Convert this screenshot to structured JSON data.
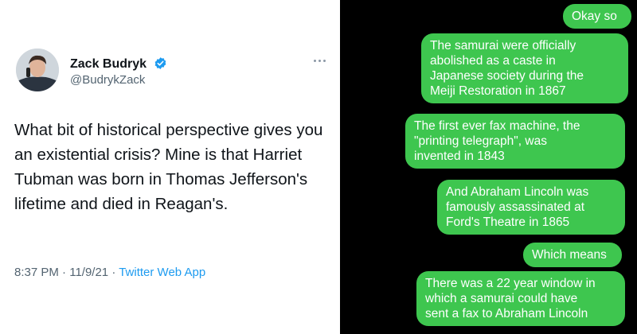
{
  "tweet": {
    "display_name": "Zack Budryk",
    "handle": "@BudrykZack",
    "text": "What bit of historical perspective gives you an existential crisis? Mine is that Harriet Tubman was born in Thomas Jefferson's lifetime and died in Reagan's.",
    "time": "8:37 PM",
    "date": "11/9/21",
    "source": "Twitter Web App",
    "separator": " · "
  },
  "chat": {
    "bubble_color": "#3ec64f",
    "messages": [
      "Okay so",
      "The samurai were officially\nabolished as a caste in\nJapanese society during the\nMeiji Restoration in 1867",
      "The first ever fax machine, the\n\"printing telegraph\", was\ninvented in 1843",
      "And Abraham Lincoln was\nfamously assassinated at\nFord's Theatre in 1865",
      "Which means",
      "There was a 22 year window in\nwhich a samurai could have\nsent a fax to Abraham Lincoln"
    ]
  },
  "icons": {
    "verified": "verified-badge-icon",
    "more": "more-options-icon"
  },
  "colors": {
    "verified_blue": "#1d9bf0",
    "chat_background": "#000000"
  }
}
